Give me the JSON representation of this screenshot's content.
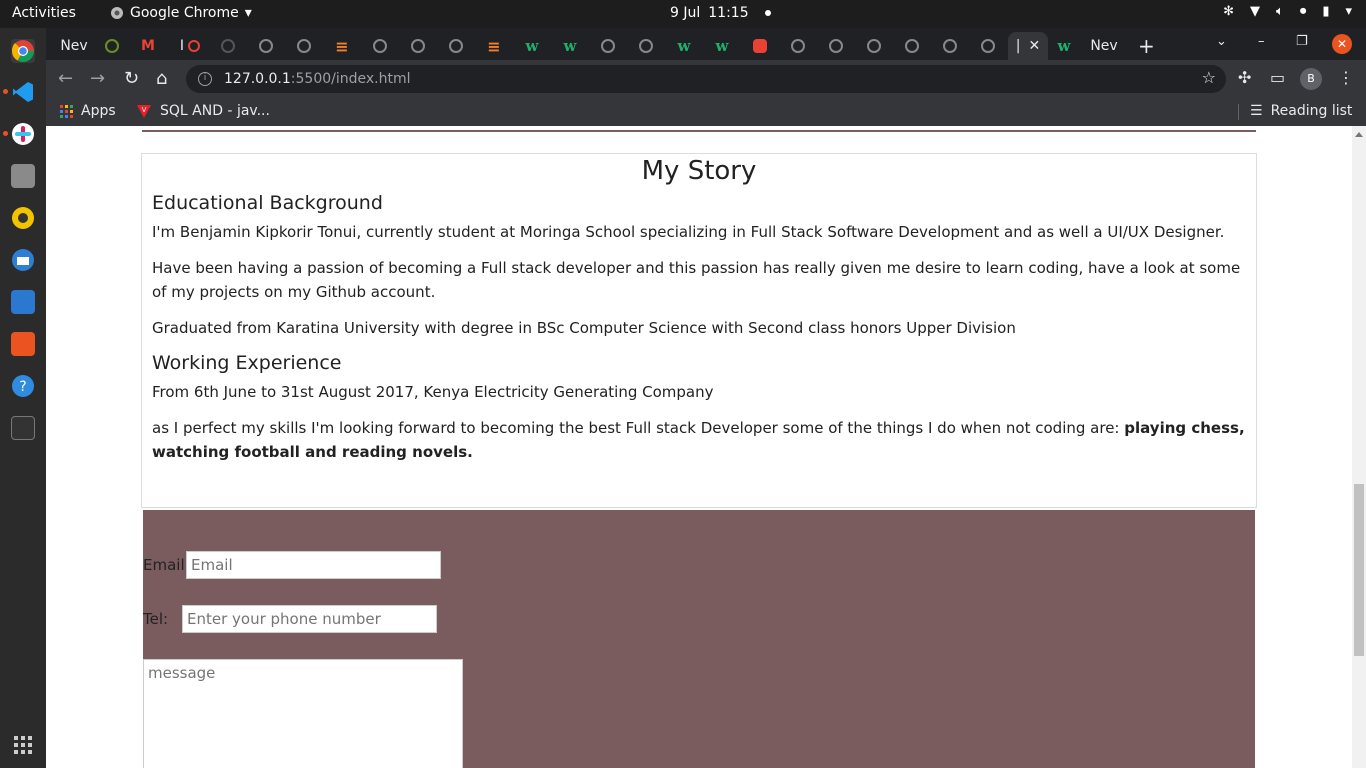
{
  "desktop": {
    "activities": "Activities",
    "app_name": "Google Chrome",
    "date": "9 Jul",
    "time": "11:15"
  },
  "browser": {
    "tabs": {
      "first_label": "Nev",
      "gmail_label": "I",
      "last_label": "Nev",
      "active_label": "|"
    },
    "url_host": "127.0.0.1",
    "url_path": ":5500/index.html",
    "avatar_initial": "B",
    "bookmarks": {
      "apps": "Apps",
      "sql": "SQL AND - jav...",
      "reading_list": "Reading list"
    }
  },
  "page": {
    "title": "My Story",
    "education": {
      "heading": "Educational Background",
      "p1": "I'm Benjamin Kipkorir Tonui, currently student at Moringa School specializing in Full Stack Software Development and as well a UI/UX Designer.",
      "p2": "Have been having a passion of becoming a Full stack developer and this passion has really given me desire to learn coding, have a look at some of my projects on my Github account.",
      "p3": "Graduated from Karatina University with degree in BSc Computer Science with Second class honors Upper Division"
    },
    "work": {
      "heading": "Working Experience",
      "p1": "From 6th June to 31st August 2017, Kenya Electricity Generating Company",
      "p2_text": "as I perfect my skills I'm looking forward to becoming the best Full stack Developer some of the things I do when not coding are: ",
      "p2_bold": "playing chess, watching football and reading novels."
    },
    "contact": {
      "email_label": "Email:",
      "email_placeholder": "Email",
      "tel_label": "Tel:",
      "tel_placeholder": "Enter your phone number",
      "message_placeholder": "message"
    }
  },
  "colors": {
    "accent": "#7a5c5e",
    "ubuntu_orange": "#e95420"
  }
}
